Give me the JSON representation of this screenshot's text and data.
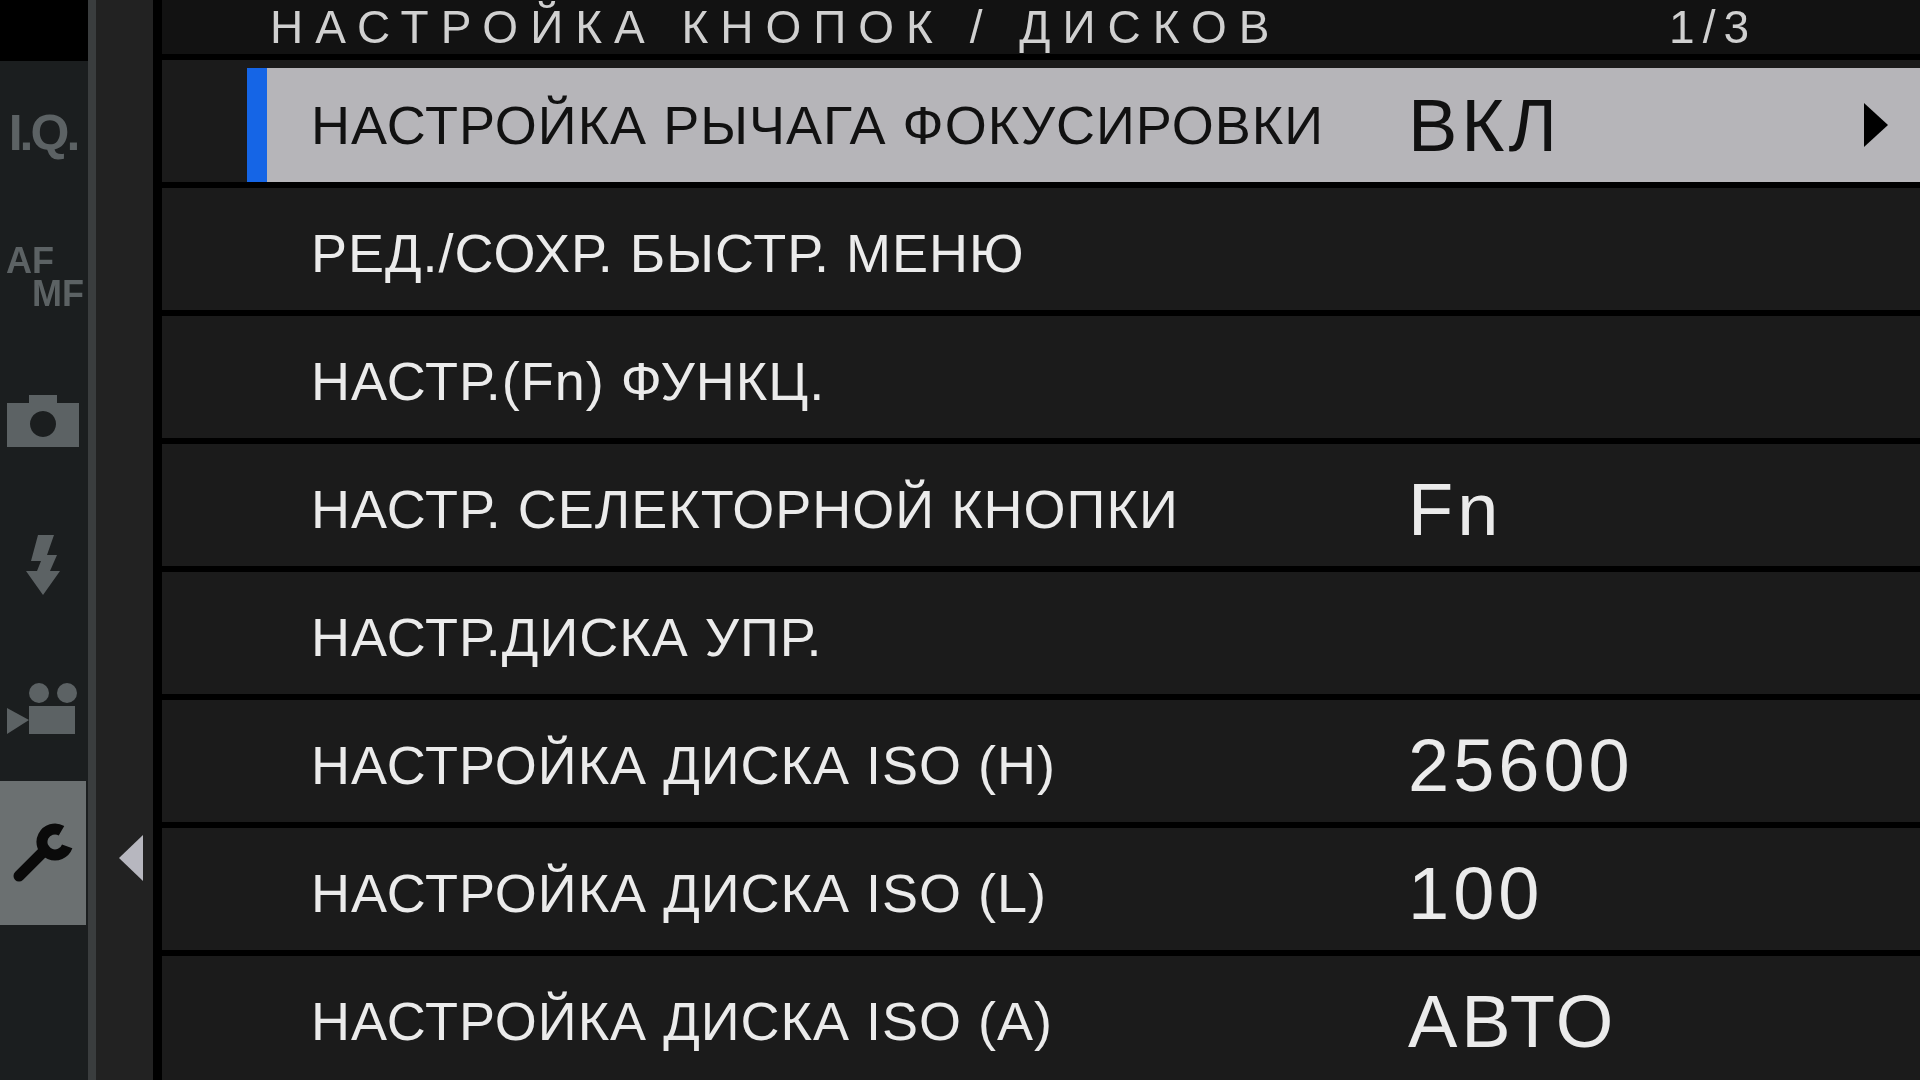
{
  "sidebar": {
    "tabs": [
      {
        "kind": "text",
        "lines": [
          "I.Q."
        ],
        "selected": false
      },
      {
        "kind": "text",
        "lines": [
          "AF",
          "MF"
        ],
        "selected": false
      },
      {
        "kind": "camera",
        "selected": false
      },
      {
        "kind": "flash",
        "selected": false
      },
      {
        "kind": "video",
        "selected": false
      },
      {
        "kind": "wrench",
        "selected": true
      }
    ]
  },
  "header": {
    "title": "НАСТРОЙКА КНОПОК / ДИСКОВ",
    "page": "1/3"
  },
  "menu": {
    "items": [
      {
        "label": "НАСТРОЙКА РЫЧАГА ФОКУСИРОВКИ",
        "value": "ВКЛ",
        "selected": true
      },
      {
        "label": "РЕД./СОХР. БЫСТР. МЕНЮ",
        "selected": false
      },
      {
        "label": "НАСТР.(Fn) ФУНКЦ.",
        "selected": false
      },
      {
        "label": "НАСТР. СЕЛЕКТОРНОЙ КНОПКИ",
        "value": "Fn",
        "selected": false
      },
      {
        "label": "НАСТР.ДИСКА УПР.",
        "selected": false
      },
      {
        "label": "НАСТРОЙКА ДИСКА ISO (H)",
        "value": "25600",
        "selected": false
      },
      {
        "label": "НАСТРОЙКА ДИСКА ISO (L)",
        "value": "100",
        "selected": false
      },
      {
        "label": "НАСТРОЙКА ДИСКА ISO (A)",
        "value": "АВТО",
        "selected": false
      }
    ]
  }
}
